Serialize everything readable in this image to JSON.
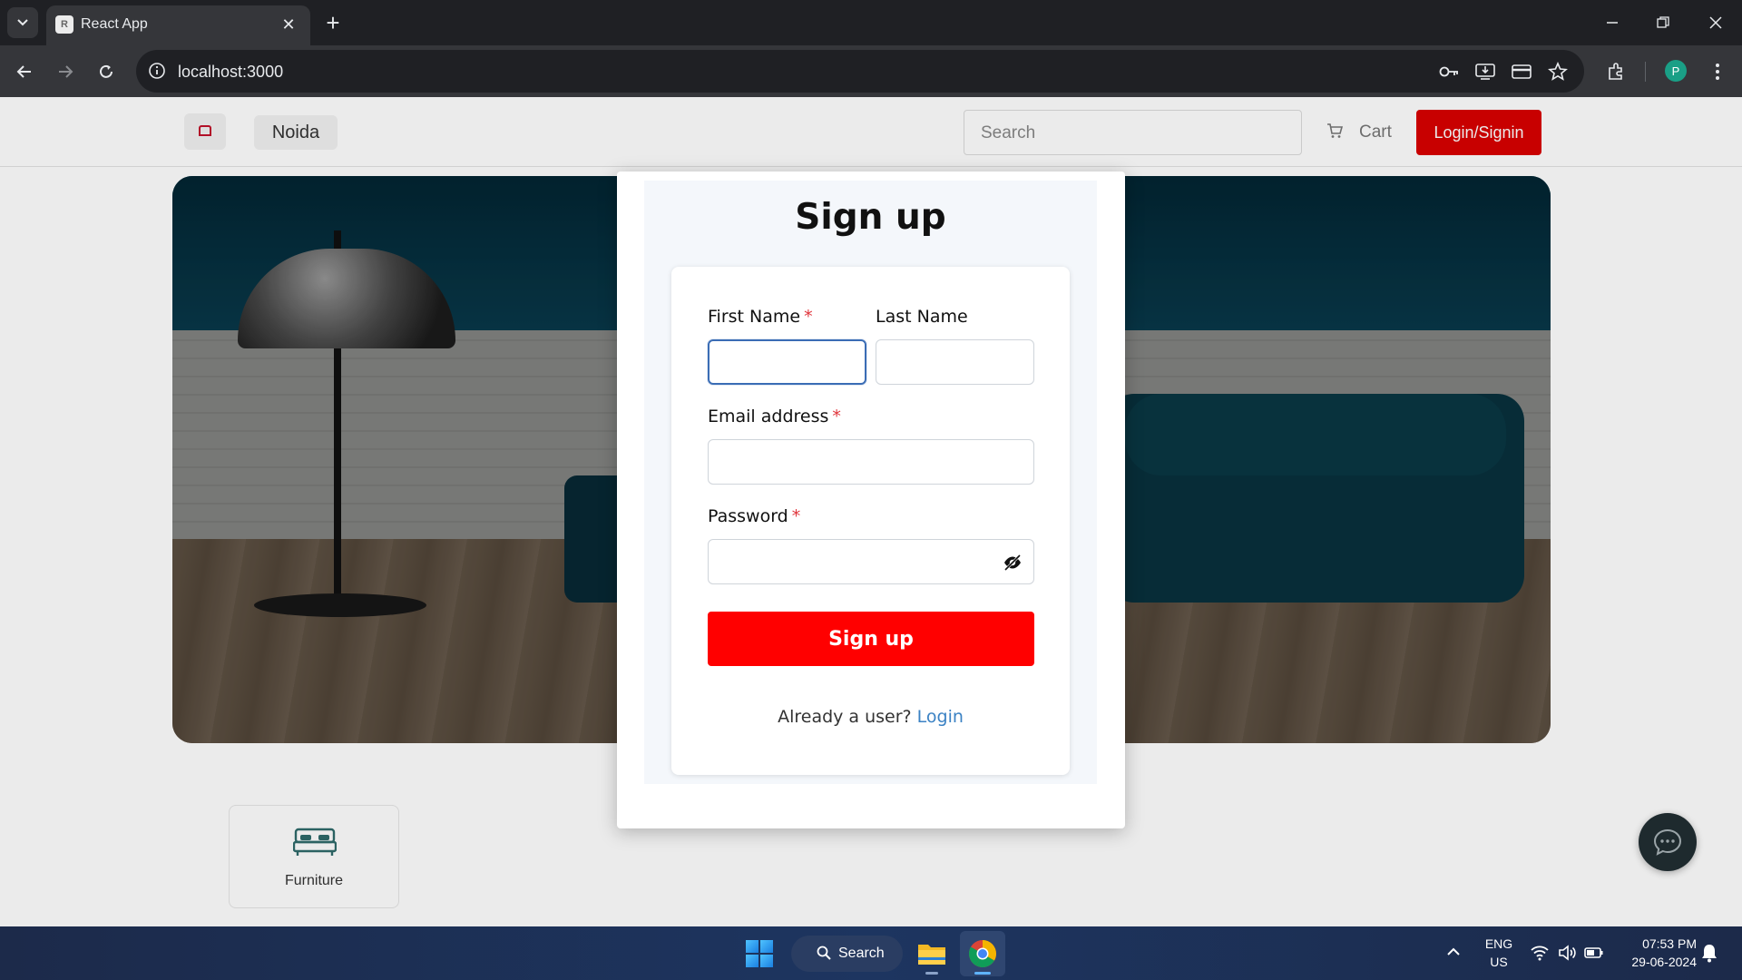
{
  "browser": {
    "tab_title": "React App",
    "url": "localhost:3000",
    "profile_initial": "P"
  },
  "site": {
    "location": "Noida",
    "search_placeholder": "Search",
    "cart_label": "Cart",
    "login_label": "Login/Signin",
    "category_label": "Furniture",
    "accent_color": "#d90000"
  },
  "modal": {
    "title": "Sign up",
    "first_name_label": "First Name",
    "last_name_label": "Last Name",
    "email_label": "Email address",
    "password_label": "Password",
    "required_mark": "*",
    "first_name_value": "",
    "last_name_value": "",
    "email_value": "",
    "password_value": "",
    "submit_label": "Sign up",
    "already_text": "Already a user?",
    "login_link": "Login",
    "submit_color": "#ff0000"
  },
  "taskbar": {
    "search_label": "Search",
    "lang_line1": "ENG",
    "lang_line2": "US",
    "time": "07:53 PM",
    "date": "29-06-2024"
  }
}
